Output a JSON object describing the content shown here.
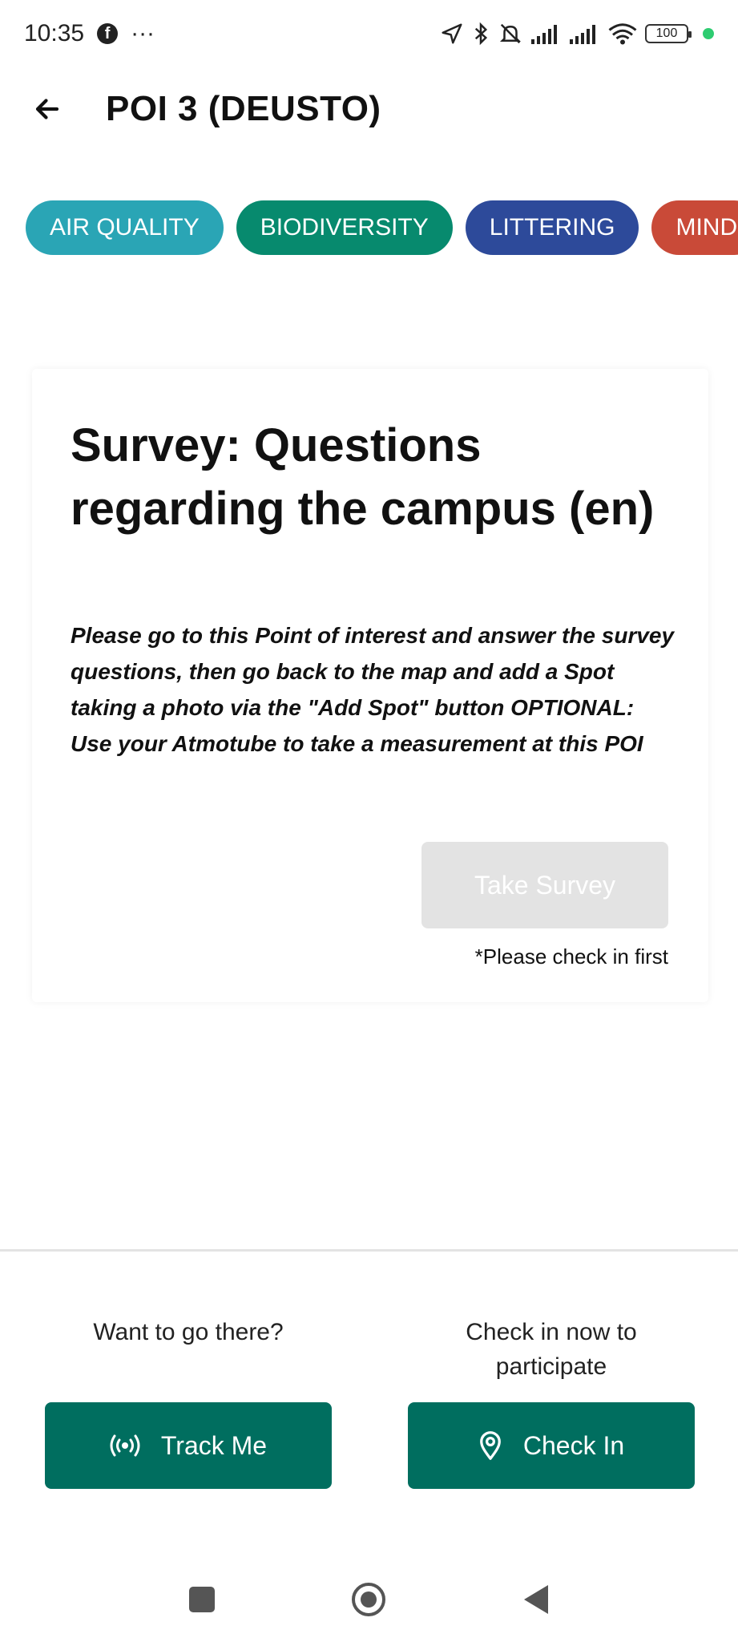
{
  "status_bar": {
    "time": "10:35",
    "fb_glyph": "f",
    "more": "···",
    "battery": "100",
    "icons": [
      "location-arrow-icon",
      "bluetooth-icon",
      "muted-bell-icon",
      "signal-icon",
      "signal-icon",
      "wifi-icon"
    ]
  },
  "header": {
    "title": "POI 3 (DEUSTO)",
    "back_icon": "arrow-left-icon"
  },
  "tabs": [
    {
      "label": "AIR QUALITY",
      "color": "#2aa5b5"
    },
    {
      "label": "BIODIVERSITY",
      "color": "#078a6e"
    },
    {
      "label": "LITTERING",
      "color": "#2d4a9a"
    },
    {
      "label": "MIND",
      "color": "#c94a38"
    }
  ],
  "card": {
    "title": "Survey: Questions regarding the campus (en)",
    "description": "Please go to this Point of interest and answer the survey questions, then go back to the map and add a Spot taking a photo via the \"Add Spot\" button OPTIONAL: Use your Atmotube to take a measurement at this POI",
    "button_label": "Take Survey",
    "note": "*Please check in first"
  },
  "bottom": {
    "track": {
      "prompt": "Want to go there?",
      "button_label": "Track Me",
      "icon": "broadcast-icon"
    },
    "checkin": {
      "prompt": "Check in now to participate",
      "button_label": "Check In",
      "icon": "location-pin-icon"
    }
  },
  "colors": {
    "primary": "#006e5f",
    "disabled": "#e3e3e3"
  },
  "nav": [
    "recents-icon",
    "home-icon",
    "back-icon"
  ]
}
